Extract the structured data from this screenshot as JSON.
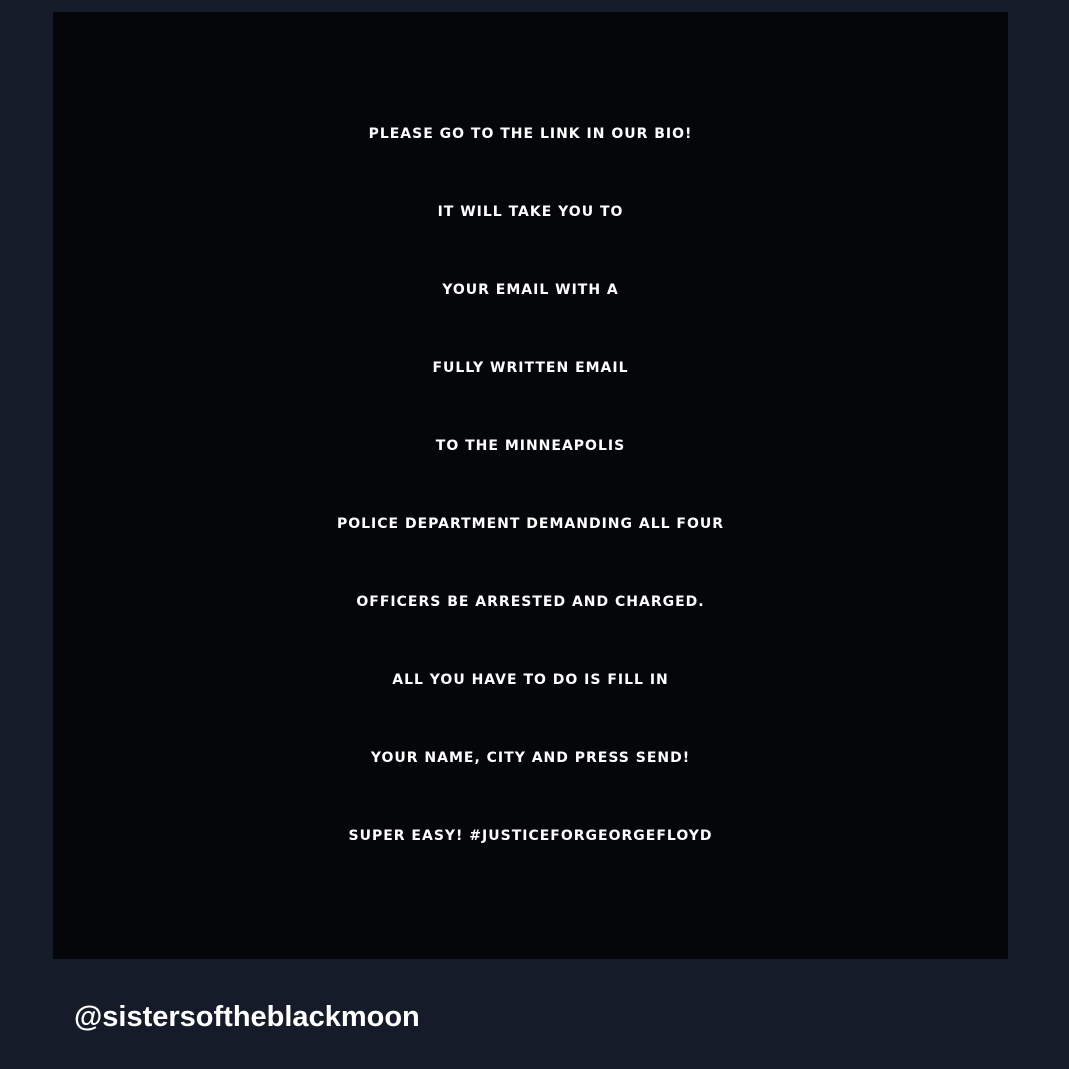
{
  "post": {
    "lines": [
      "PLEASE GO TO THE LINK IN OUR BIO!",
      "IT WILL TAKE YOU TO",
      "YOUR EMAIL WITH A",
      "FULLY WRITTEN EMAIL",
      "TO THE MINNEAPOLIS",
      "POLICE DEPARTMENT DEMANDING ALL FOUR",
      "OFFICERS BE ARRESTED AND CHARGED.",
      "ALL YOU HAVE TO DO IS FILL IN",
      "YOUR NAME, CITY AND PRESS SEND!",
      "SUPER EASY! #JUSTICEFORGEORGEFLOYD"
    ]
  },
  "footer": {
    "handle": "@sistersoftheblackmoon"
  },
  "colors": {
    "page_background": "#151b28",
    "card_background": "#050609",
    "text": "#ffffff"
  }
}
